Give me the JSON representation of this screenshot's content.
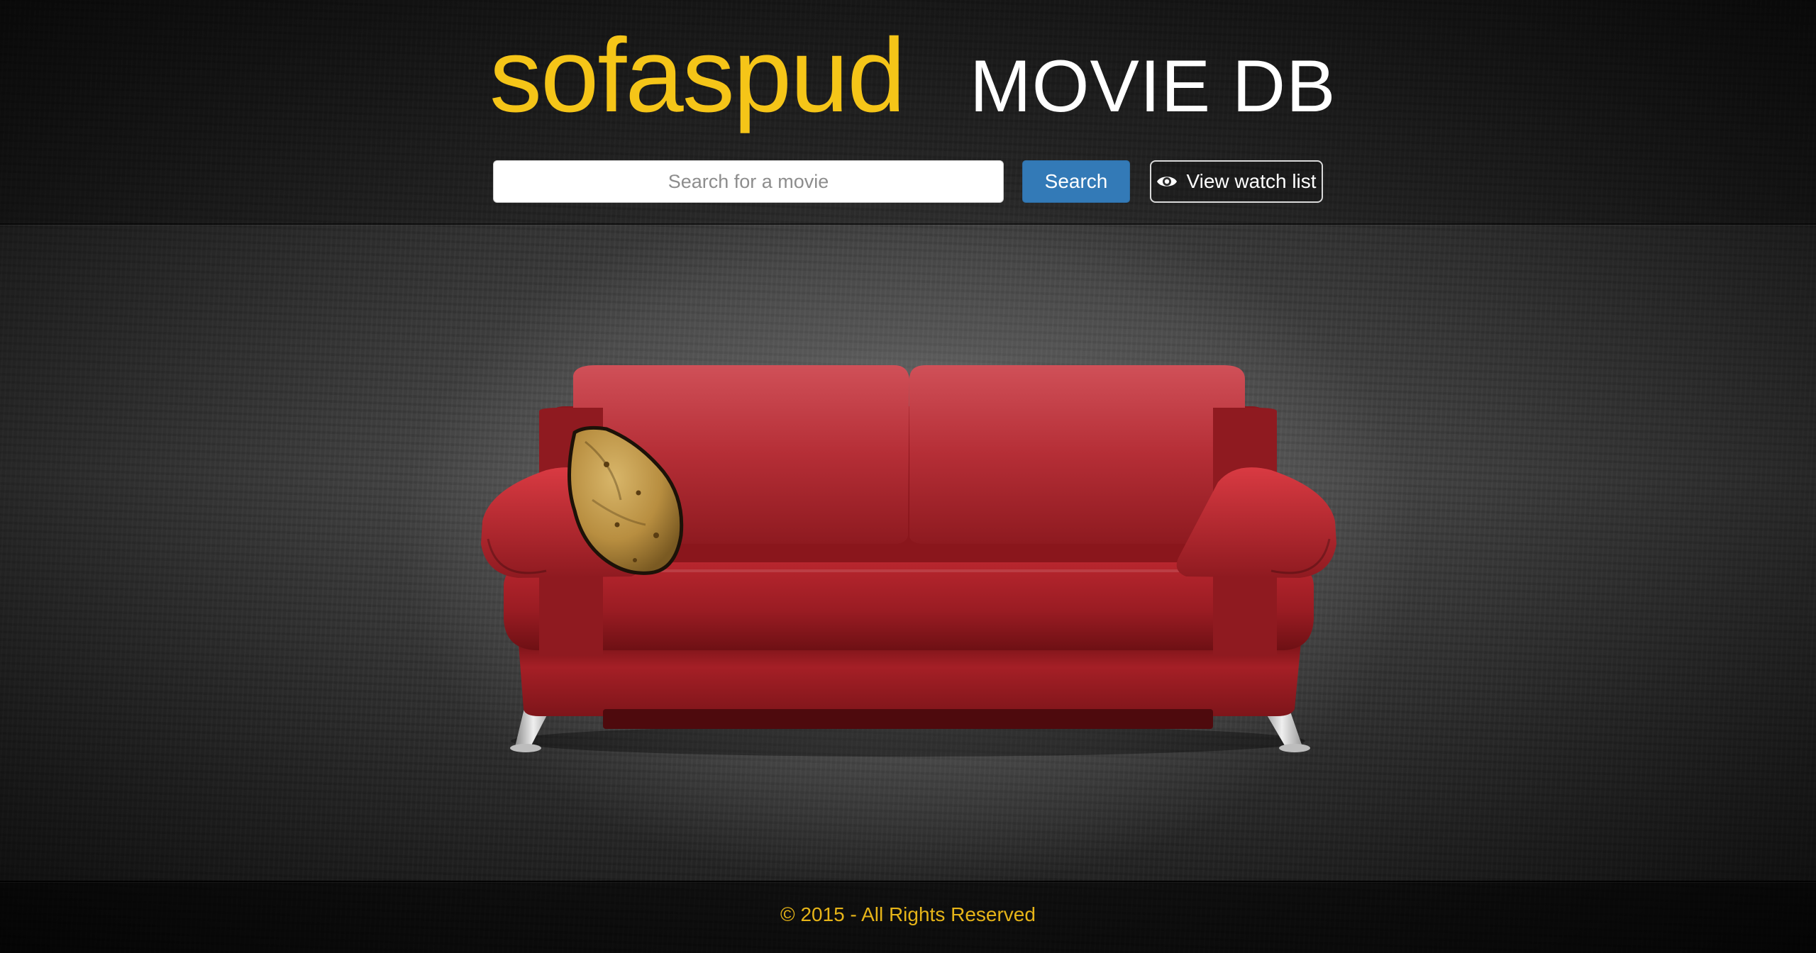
{
  "header": {
    "brand": "sofaspud",
    "subtitle": "MOVIE DB",
    "search_placeholder": "Search for a movie",
    "search_button": "Search",
    "watch_list_button": "View watch list",
    "watch_list_icon": "eye-icon"
  },
  "hero": {
    "image": "red-sofa-with-potato-illustration"
  },
  "footer": {
    "copyright": "© 2015 - All Rights Reserved"
  },
  "colors": {
    "brand_yellow": "#f5c518",
    "button_blue": "#337ab7",
    "sofa_red": "#a8222a",
    "footer_text": "#e6b418"
  }
}
